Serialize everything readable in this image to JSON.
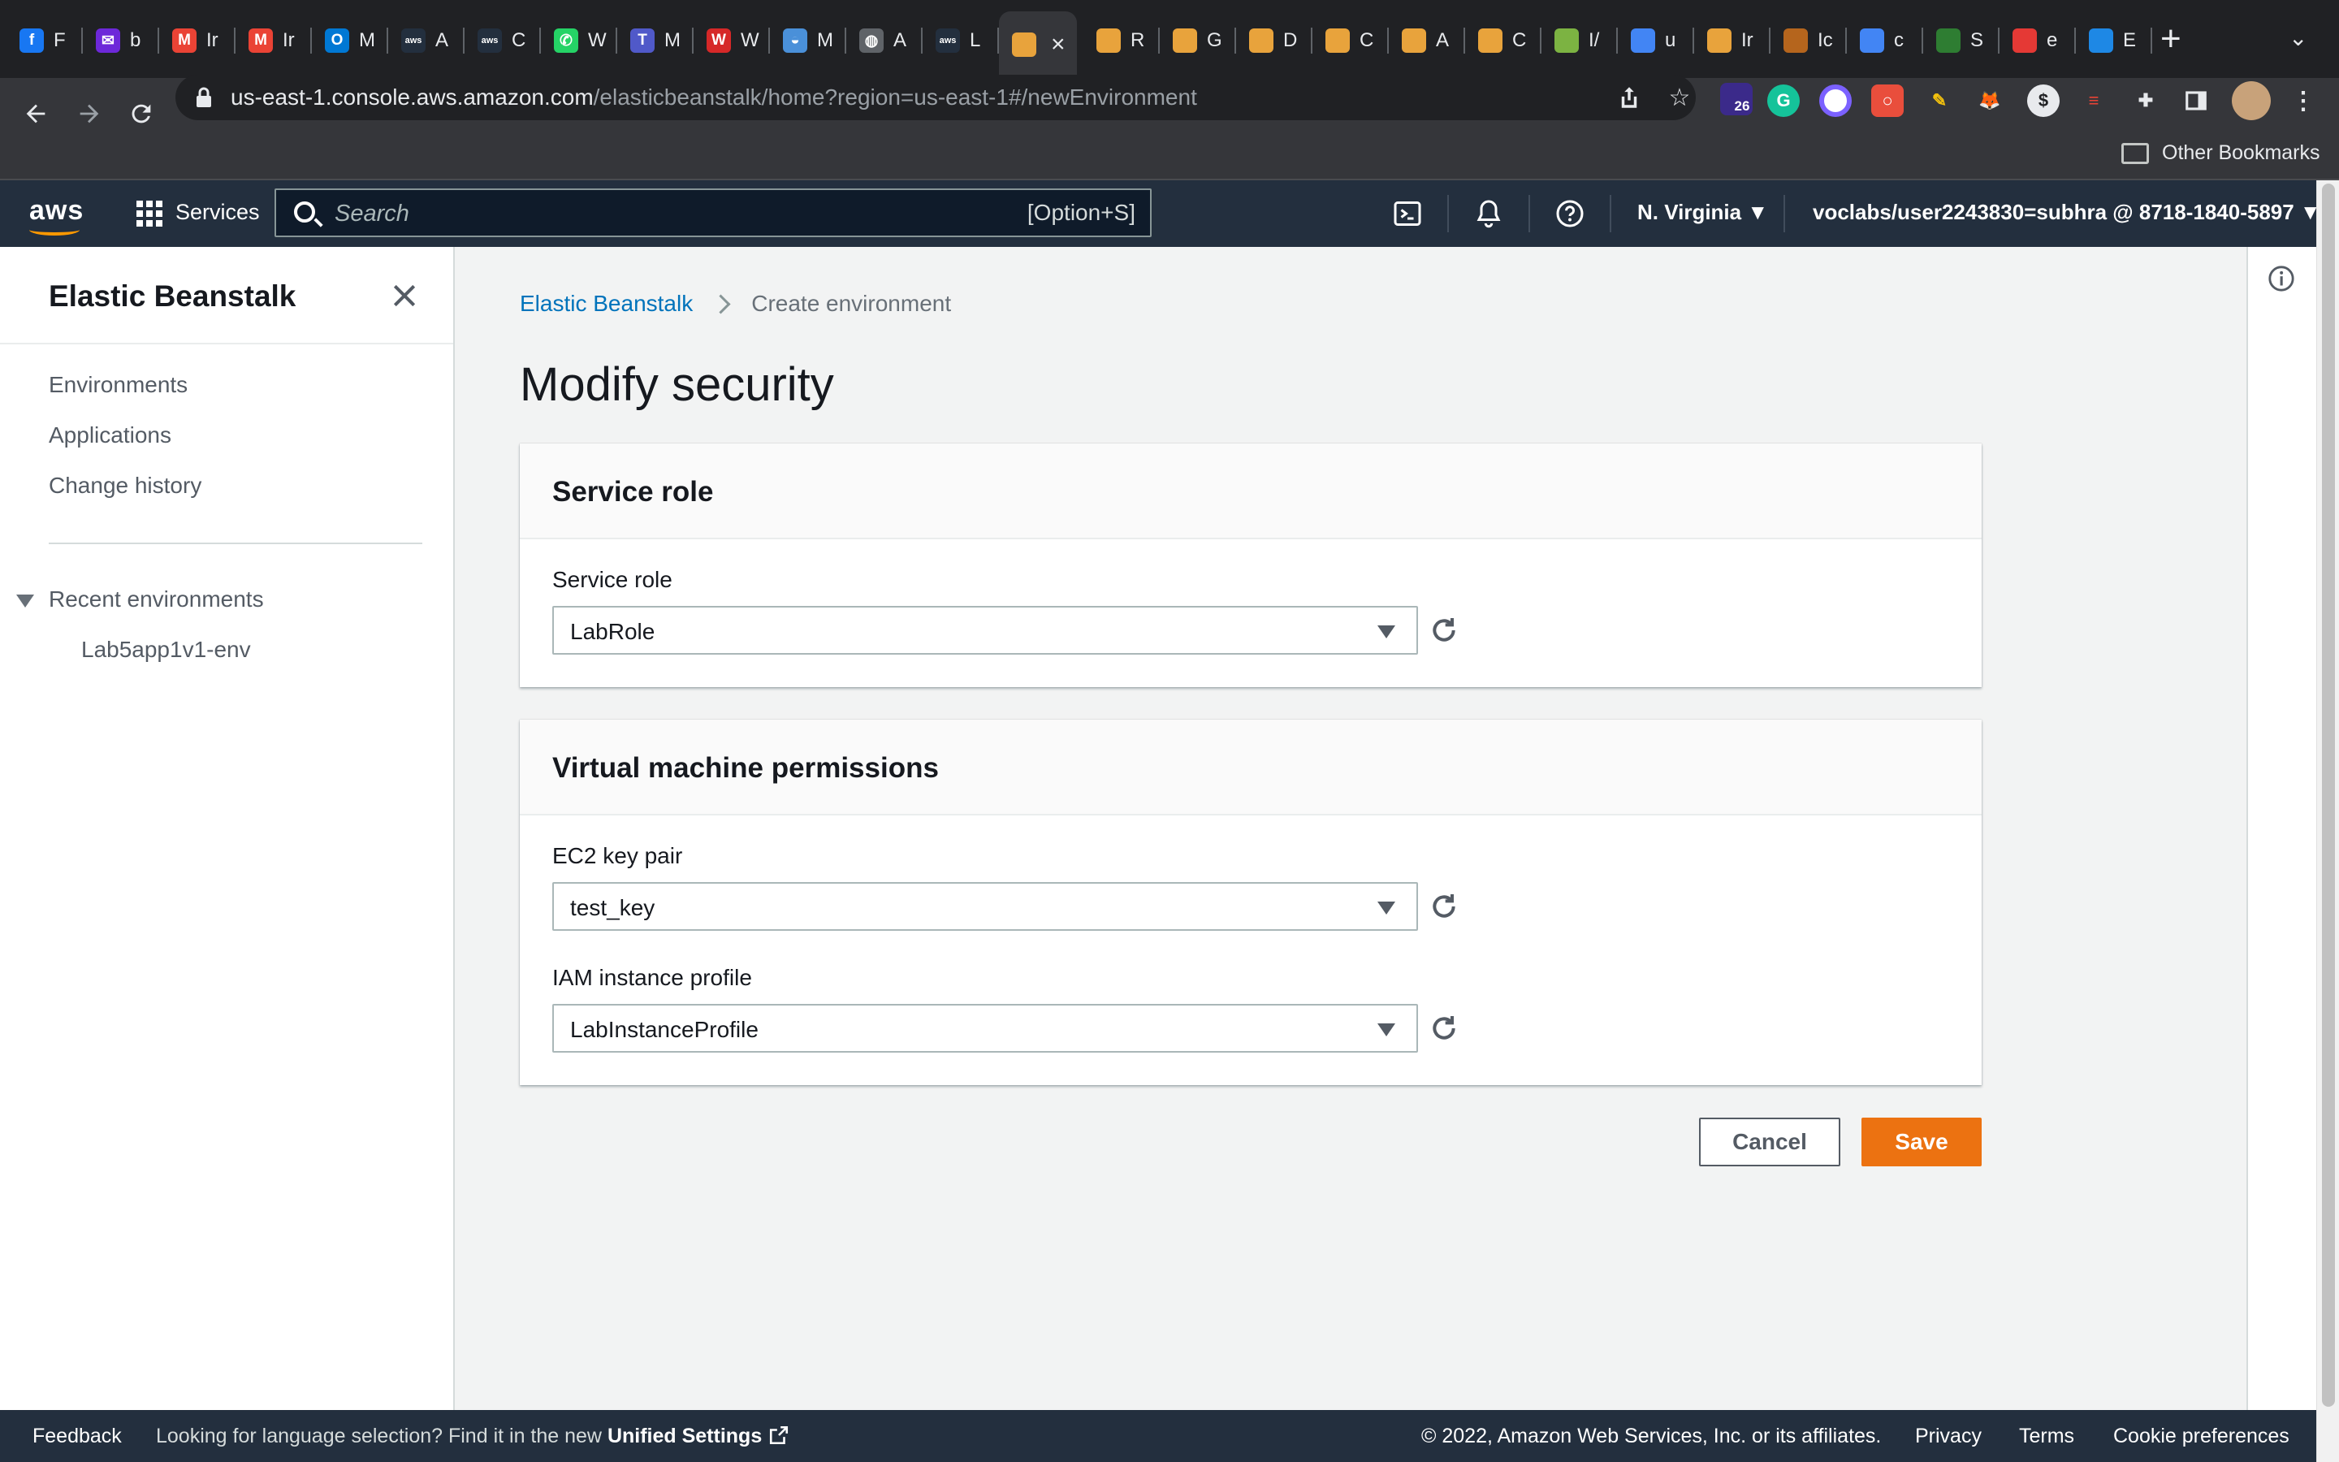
{
  "browser": {
    "tabs": [
      {
        "initial": "F",
        "color": "#1877f2",
        "glyph": "f"
      },
      {
        "initial": "b",
        "color": "#6d28d9",
        "glyph": "✉"
      },
      {
        "initial": "Ir",
        "color": "#ea4335",
        "glyph": "M"
      },
      {
        "initial": "Ir",
        "color": "#ea4335",
        "glyph": "M"
      },
      {
        "initial": "M",
        "color": "#0078d4",
        "glyph": "O"
      },
      {
        "initial": "A",
        "color": "#232f3e",
        "glyph": "aws"
      },
      {
        "initial": "C",
        "color": "#232f3e",
        "glyph": "aws"
      },
      {
        "initial": "W",
        "color": "#25d366",
        "glyph": "✆"
      },
      {
        "initial": "M",
        "color": "#5059c9",
        "glyph": "T"
      },
      {
        "initial": "W",
        "color": "#d62828",
        "glyph": "W"
      },
      {
        "initial": "M",
        "color": "#4a90d9",
        "glyph": "◒"
      },
      {
        "initial": "A",
        "color": "#5f6368",
        "glyph": "◍"
      },
      {
        "initial": "L",
        "color": "#232f3e",
        "glyph": "aws"
      }
    ],
    "active_tab_color": "#e8a33c",
    "tabs_after": [
      {
        "initial": "R",
        "color": "#e8a33c"
      },
      {
        "initial": "G",
        "color": "#e8a33c"
      },
      {
        "initial": "D",
        "color": "#e8a33c"
      },
      {
        "initial": "C",
        "color": "#e8a33c"
      },
      {
        "initial": "A",
        "color": "#e8a33c"
      },
      {
        "initial": "C",
        "color": "#e8a33c"
      },
      {
        "initial": "I/",
        "color": "#7cb342"
      },
      {
        "initial": "u",
        "color": "#4285f4"
      },
      {
        "initial": "Ir",
        "color": "#e8a33c"
      },
      {
        "initial": "Ic",
        "color": "#b5651d"
      },
      {
        "initial": "c",
        "color": "#4285f4"
      },
      {
        "initial": "S",
        "color": "#2e7d32"
      },
      {
        "initial": "e",
        "color": "#e53935"
      },
      {
        "initial": "E",
        "color": "#1e88e5"
      }
    ],
    "url_host": "us-east-1.console.aws.amazon.com",
    "url_path": "/elasticbeanstalk/home?region=us-east-1#/newEnvironment",
    "extensions_badge": "26",
    "other_bookmarks": "Other Bookmarks"
  },
  "aws_header": {
    "logo": "aws",
    "services": "Services",
    "search_placeholder": "Search",
    "search_shortcut": "[Option+S]",
    "region": "N. Virginia",
    "account": "voclabs/user2243830=subhra @ 8718-1840-5897"
  },
  "sidenav": {
    "title": "Elastic Beanstalk",
    "items": [
      "Environments",
      "Applications",
      "Change history"
    ],
    "recent_title": "Recent environments",
    "recent_items": [
      "Lab5app1v1-env"
    ]
  },
  "main": {
    "breadcrumb": [
      "Elastic Beanstalk",
      "Create environment"
    ],
    "title": "Modify security",
    "service_role_panel": {
      "heading": "Service role",
      "field_label": "Service role",
      "value": "LabRole"
    },
    "vm_panel": {
      "heading": "Virtual machine permissions",
      "key_pair_label": "EC2 key pair",
      "key_pair_value": "test_key",
      "iam_label": "IAM instance profile",
      "iam_value": "LabInstanceProfile"
    },
    "cancel": "Cancel",
    "save": "Save"
  },
  "footer": {
    "feedback": "Feedback",
    "lang_prefix": "Looking for language selection? Find it in the new",
    "lang_link": "Unified Settings",
    "copyright": "© 2022, Amazon Web Services, Inc. or its affiliates.",
    "privacy": "Privacy",
    "terms": "Terms",
    "cookies": "Cookie preferences"
  },
  "colors": {
    "aws_nav": "#232f3e",
    "link": "#0073bb",
    "primary_button": "#ec7211",
    "aws_orange": "#ff9900"
  }
}
